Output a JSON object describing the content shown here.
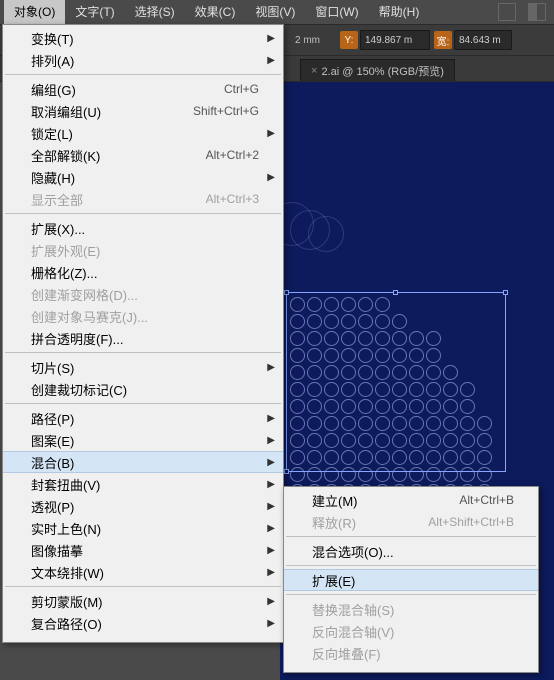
{
  "menubar": {
    "items": [
      "对象(O)",
      "文字(T)",
      "选择(S)",
      "效果(C)",
      "视图(V)",
      "窗口(W)",
      "帮助(H)"
    ],
    "active_index": 0
  },
  "toolbar": {
    "y_label": "Y:",
    "y_value": "149.867 m",
    "w_label": "宽:",
    "w_value": "84.643 m",
    "extra_value": "2 mm"
  },
  "tab": {
    "close": "×",
    "title": "2.ai @ 150% (RGB/预览)"
  },
  "object_menu": {
    "groups": [
      [
        {
          "label": "变换(T)",
          "sub": true
        },
        {
          "label": "排列(A)",
          "sub": true
        }
      ],
      [
        {
          "label": "编组(G)",
          "shortcut": "Ctrl+G"
        },
        {
          "label": "取消编组(U)",
          "shortcut": "Shift+Ctrl+G"
        },
        {
          "label": "锁定(L)",
          "sub": true
        },
        {
          "label": "全部解锁(K)",
          "shortcut": "Alt+Ctrl+2"
        },
        {
          "label": "隐藏(H)",
          "sub": true
        },
        {
          "label": "显示全部",
          "shortcut": "Alt+Ctrl+3",
          "disabled": true
        }
      ],
      [
        {
          "label": "扩展(X)..."
        },
        {
          "label": "扩展外观(E)",
          "disabled": true
        },
        {
          "label": "栅格化(Z)..."
        },
        {
          "label": "创建渐变网格(D)...",
          "disabled": true
        },
        {
          "label": "创建对象马赛克(J)...",
          "disabled": true
        },
        {
          "label": "拼合透明度(F)..."
        }
      ],
      [
        {
          "label": "切片(S)",
          "sub": true
        },
        {
          "label": "创建裁切标记(C)"
        }
      ],
      [
        {
          "label": "路径(P)",
          "sub": true
        },
        {
          "label": "图案(E)",
          "sub": true
        },
        {
          "label": "混合(B)",
          "sub": true,
          "hl": true
        },
        {
          "label": "封套扭曲(V)",
          "sub": true
        },
        {
          "label": "透视(P)",
          "sub": true
        },
        {
          "label": "实时上色(N)",
          "sub": true
        },
        {
          "label": "图像描摹",
          "sub": true
        },
        {
          "label": "文本绕排(W)",
          "sub": true
        }
      ],
      [
        {
          "label": "剪切蒙版(M)",
          "sub": true
        },
        {
          "label": "复合路径(O)",
          "sub": true
        }
      ]
    ]
  },
  "blend_submenu": {
    "groups": [
      [
        {
          "label": "建立(M)",
          "shortcut": "Alt+Ctrl+B"
        },
        {
          "label": "释放(R)",
          "shortcut": "Alt+Shift+Ctrl+B",
          "disabled": true
        }
      ],
      [
        {
          "label": "混合选项(O)..."
        }
      ],
      [
        {
          "label": "扩展(E)",
          "hl": true
        }
      ],
      [
        {
          "label": "替换混合轴(S)",
          "disabled": true
        },
        {
          "label": "反向混合轴(V)",
          "disabled": true
        },
        {
          "label": "反向堆叠(F)",
          "disabled": true
        }
      ]
    ]
  }
}
